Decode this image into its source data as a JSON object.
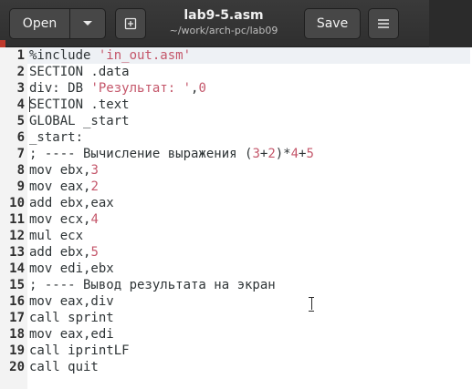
{
  "header": {
    "open_label": "Open",
    "save_label": "Save",
    "title": "lab9-5.asm",
    "subtitle": "~/work/arch-pc/lab09",
    "icons": [
      "chevron-down-icon",
      "new-tab-icon",
      "hamburger-menu-icon"
    ]
  },
  "editor": {
    "line_numbers": [
      "1",
      "2",
      "3",
      "4",
      "5",
      "6",
      "7",
      "8",
      "9",
      "10",
      "11",
      "12",
      "13",
      "14",
      "15",
      "16",
      "17",
      "18",
      "19",
      "20"
    ],
    "lines": [
      [
        {
          "t": "%include ",
          "c": "plain"
        },
        {
          "t": "'in_out.asm'",
          "c": "str"
        }
      ],
      [
        {
          "t": "SECTION .data",
          "c": "plain"
        }
      ],
      [
        {
          "t": "div: DB ",
          "c": "plain"
        },
        {
          "t": "'Результат: '",
          "c": "str"
        },
        {
          "t": ",",
          "c": "plain"
        },
        {
          "t": "0",
          "c": "num"
        }
      ],
      [
        {
          "t": "SECTION .text",
          "c": "plain"
        }
      ],
      [
        {
          "t": "GLOBAL _start",
          "c": "plain"
        }
      ],
      [
        {
          "t": "_start:",
          "c": "plain"
        }
      ],
      [
        {
          "t": "; ---- Вычисление выражения (",
          "c": "cmt"
        },
        {
          "t": "3",
          "c": "num"
        },
        {
          "t": "+",
          "c": "plain"
        },
        {
          "t": "2",
          "c": "num"
        },
        {
          "t": ")*",
          "c": "plain"
        },
        {
          "t": "4",
          "c": "num"
        },
        {
          "t": "+",
          "c": "plain"
        },
        {
          "t": "5",
          "c": "num"
        }
      ],
      [
        {
          "t": "mov ebx,",
          "c": "plain"
        },
        {
          "t": "3",
          "c": "num"
        }
      ],
      [
        {
          "t": "mov eax,",
          "c": "plain"
        },
        {
          "t": "2",
          "c": "num"
        }
      ],
      [
        {
          "t": "add ebx,eax",
          "c": "plain"
        }
      ],
      [
        {
          "t": "mov ecx,",
          "c": "plain"
        },
        {
          "t": "4",
          "c": "num"
        }
      ],
      [
        {
          "t": "mul ecx",
          "c": "plain"
        }
      ],
      [
        {
          "t": "add ebx,",
          "c": "plain"
        },
        {
          "t": "5",
          "c": "num"
        }
      ],
      [
        {
          "t": "mov edi,ebx",
          "c": "plain"
        }
      ],
      [
        {
          "t": "; ---- Вывод результата на экран",
          "c": "cmt"
        }
      ],
      [
        {
          "t": "mov eax,div",
          "c": "plain"
        }
      ],
      [
        {
          "t": "call sprint",
          "c": "plain"
        }
      ],
      [
        {
          "t": "mov eax,edi",
          "c": "plain"
        }
      ],
      [
        {
          "t": "call iprintLF",
          "c": "plain"
        }
      ],
      [
        {
          "t": "call quit",
          "c": "plain"
        }
      ]
    ]
  },
  "colors": {
    "headerbar": "#333333",
    "string_literal": "#c4566a",
    "number_literal": "#c4566a",
    "text": "#2e3436"
  }
}
